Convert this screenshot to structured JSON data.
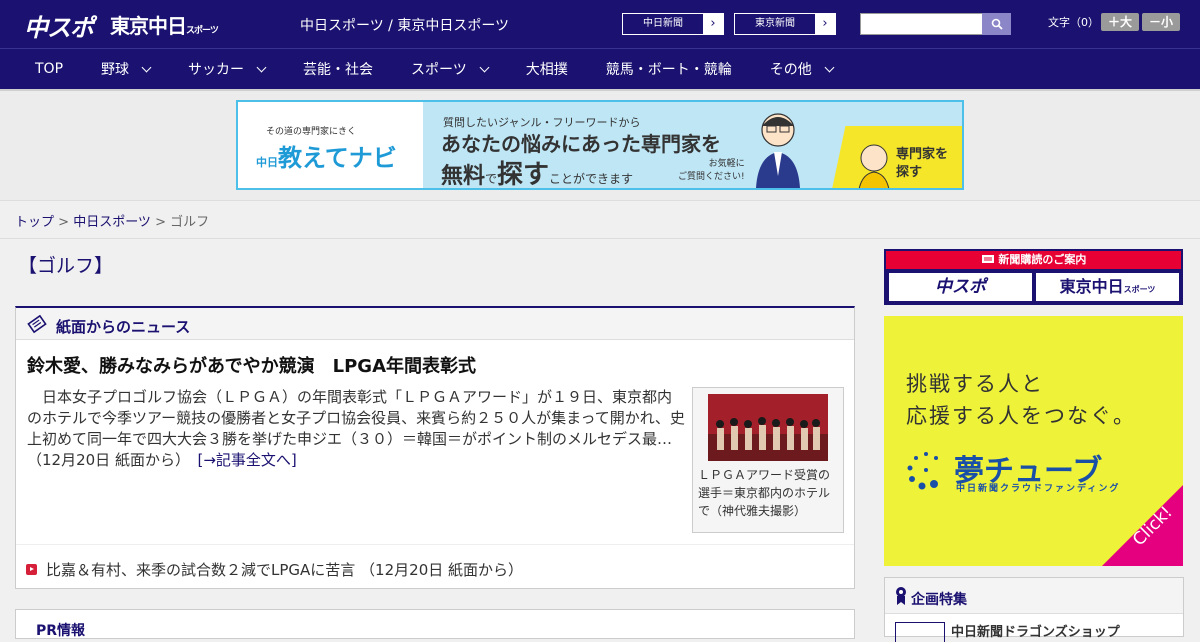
{
  "header": {
    "logo_chuspo": "中スポ",
    "logo_tokyo": "東京中日",
    "logo_tokyo_small": "スポーツ",
    "site_name": "中日スポーツ / 東京中日スポーツ",
    "paper1_label": "中日新聞",
    "paper2_label": "東京新聞",
    "arrow": "›",
    "font_size_label": "文字（0）",
    "font_large": "＋大",
    "font_small": "－小"
  },
  "nav": {
    "items": [
      {
        "label": "TOP",
        "has_menu": false
      },
      {
        "label": "野球",
        "has_menu": true
      },
      {
        "label": "サッカー",
        "has_menu": true
      },
      {
        "label": "芸能・社会",
        "has_menu": false
      },
      {
        "label": "スポーツ",
        "has_menu": true
      },
      {
        "label": "大相撲",
        "has_menu": false
      },
      {
        "label": "競馬・ボート・競輪",
        "has_menu": false
      },
      {
        "label": "その他",
        "has_menu": true
      }
    ]
  },
  "banner": {
    "left_small": "その道の専門家にきく",
    "left_brand": "教えてナビ",
    "left_prefix": "中日",
    "line1": "質問したいジャンル・フリーワードから",
    "line2": "あなたの悩みにあった専門家を",
    "line3_a": "無料",
    "line3_b": "で",
    "line3_c": "探す",
    "line3_d": "ことができます",
    "note1": "お気軽に",
    "note2": "ご質問ください!",
    "cta1": "専門家を",
    "cta2": "探す"
  },
  "breadcrumb": {
    "home": "トップ",
    "sep": " > ",
    "section": "中日スポーツ",
    "current": "ゴルフ"
  },
  "page_title": "【ゴルフ】",
  "news": {
    "section_title": "紙面からのニュース",
    "headline": "鈴木愛、勝みなみらがあでやか競演　LPGA年間表彰式",
    "body": "　日本女子プロゴルフ協会（ＬＰＧＡ）の年間表彰式「ＬＰＧＡアワード」が１９日、東京都内のホテルで今季ツアー競技の優勝者と女子プロ協会役員、来賓ら約２５０人が集まって開かれ、史上初めて同一年で四大大会３勝を挙げた申ジエ（３０）＝韓国＝がポイント制のメルセデス最…（12月20日 紙面から）",
    "more": "[→記事全文へ]",
    "photo_caption": "ＬＰＧＡアワード受賞の選手＝東京都内のホテルで（神代雅夫撮影）",
    "related": "比嘉＆有村、来季の試合数２減でLPGAに苦言 （12月20日 紙面から）"
  },
  "pr": {
    "title": "PR情報"
  },
  "sidebar": {
    "subscribe_header": "新聞購読のご案内",
    "subscribe_chuspo": "中スポ",
    "subscribe_tokyo": "東京中日",
    "subscribe_tokyo_small": "スポーツ",
    "yume_line1": "挑戦する人と",
    "yume_line2": "応援する人をつなぐ。",
    "yume_brand": "夢チューブ",
    "yume_sub": "中日新聞クラウドファンディング",
    "yume_click": "Click!",
    "kikaku_title": "企画特集",
    "kikaku_item": "中日新聞ドラゴンズショップ"
  },
  "colors": {
    "brand_navy": "#1a1170",
    "accent_red": "#e60033",
    "banner_blue": "#4cc0e8",
    "yume_yellow": "#eef33a",
    "yume_magenta": "#e4007f"
  }
}
